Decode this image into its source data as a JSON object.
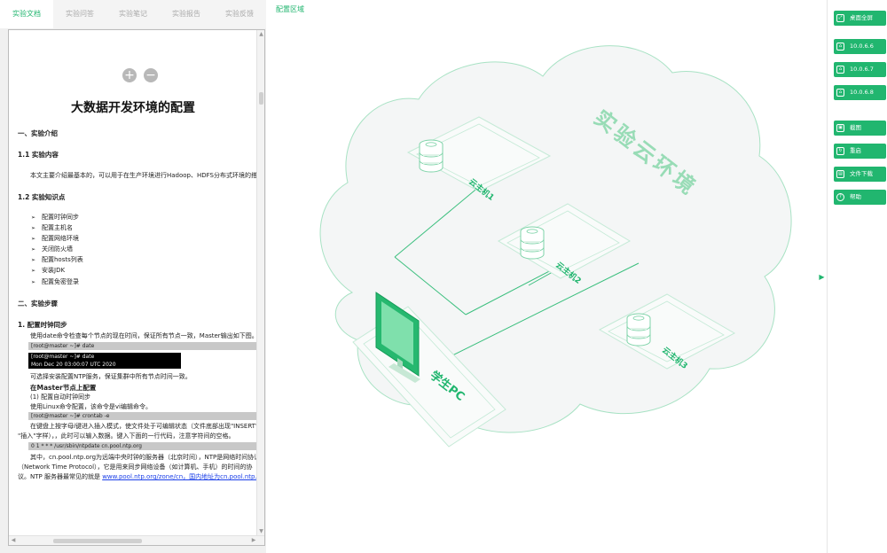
{
  "tabs": [
    "实验文档",
    "实验问答",
    "实验笔记",
    "实验报告",
    "实验反馈"
  ],
  "doc": {
    "zoom_in": "+",
    "zoom_out": "−",
    "title": "大数据开发环境的配置",
    "s1": "一、实验介绍",
    "s1_1": "1.1 实验内容",
    "s1_1_text": "本文主要介绍最基本的，可以用于在生产环境进行Hadoop、HDFS分布式环境的搭建。",
    "s1_2": "1.2 实验知识点",
    "points": [
      "配置时钟同步",
      "配置主机名",
      "配置网络环境",
      "关闭防火墙",
      "配置hosts列表",
      "安装JDK",
      "配置免密登录"
    ],
    "s2": "二、实验步骤",
    "step1": "1. 配置时钟同步",
    "step1_text": "使用date命令检查每个节点的现在时间，保证所有节点一致，Master输出如下图。",
    "cmd_date": "[root@master ~]# date",
    "term_line1": "[root@master ~]# date",
    "term_line2": "Mon Dec 20 03:00:07 UTC 2020",
    "ntp_text": "可选择安装配置NTP服务，保证集群中所有节点时间一致。",
    "on_master": "在Master节点上配置",
    "auto_sync": "(1) 配置自动时钟同步",
    "crontab_hint": "使用Linux命令配置，该命令是vi编辑命令。",
    "cmd_crontab": "[root@master ~]# crontab -e",
    "insert_1": "在键盘上按字母i键进入插入模式，使文件处于可编辑状态（文件底部出现\"INSERT\"或",
    "insert_2": "\"插入\"字样），，此时可以输入数据。键入下面的一行代码，注意字符间的空格。",
    "cmd_cron": "0 1 * * * /usr/sbin/ntpdate cn.pool.ntp.org",
    "para_1": "其中，cn.pool.ntp.org为远端中央时钟的服务器（北京时间），NTP是网络时间协议",
    "para_2": "（Network    Time    Protocol），它是用来同步网络设备（如计算机、手机）的时间的协",
    "para_3": "议。NTP 服务器最常见的就是",
    "para_link": "www.pool.ntp.org/zone/cn，国内地址为cn.pool.ntp.org。"
  },
  "main": {
    "area_label": "配置区域",
    "cloud_label": "实验云环境",
    "hosts": [
      "云主机1",
      "云主机2",
      "云主机3"
    ],
    "pc_label": "学生PC"
  },
  "toolbar": {
    "fullscreen": "桌面全屏",
    "vms": [
      "10.0.6.6",
      "10.0.6.7",
      "10.0.6.8"
    ],
    "screenshot": "截图",
    "reset": "重启",
    "download": "文件下载",
    "help": "帮助"
  },
  "colors": {
    "accent": "#21b66f",
    "cloud_fill": "#f4f6f6",
    "outline": "#a8e2c4"
  }
}
